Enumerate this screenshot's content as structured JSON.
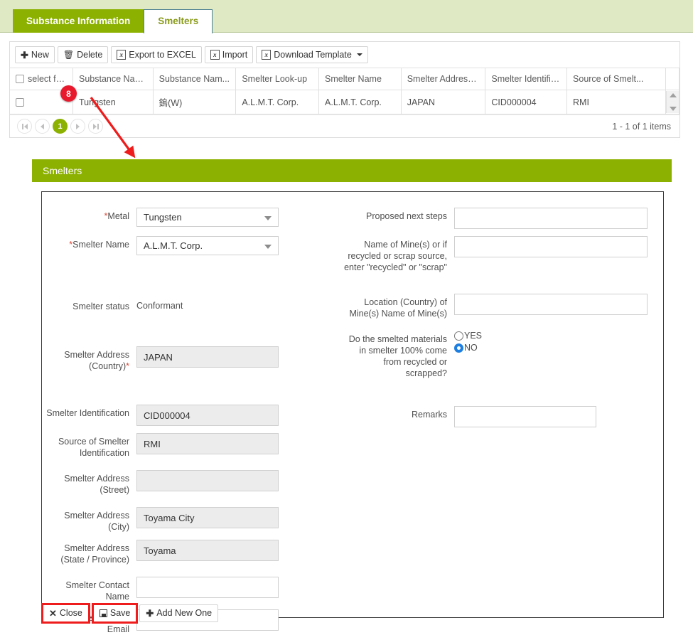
{
  "tabs": [
    {
      "label": "Substance Information",
      "state": "green"
    },
    {
      "label": "Smelters",
      "state": "selected"
    }
  ],
  "toolbar": {
    "new_label": "New",
    "delete_label": "Delete",
    "export_label": "Export to EXCEL",
    "import_label": "Import",
    "template_label": "Download Template",
    "excel_icon_text": "x"
  },
  "grid": {
    "headers": [
      "select fo...",
      "Substance Nam...",
      "Substance Nam...",
      "Smelter Look-up",
      "Smelter Name",
      "Smelter Address...",
      "Smelter Identific...",
      "Source of Smelt..."
    ],
    "rows": [
      {
        "substance_name_en": "Tungsten",
        "substance_name_local": "鎢(W)",
        "smelter_lookup": "A.L.M.T. Corp.",
        "smelter_name": "A.L.M.T. Corp.",
        "smelter_address": "JAPAN",
        "smelter_identification": "CID000004",
        "source_of_smelter": "RMI"
      }
    ],
    "pager": {
      "current_page": "1",
      "items_text": "1 - 1 of 1 items"
    }
  },
  "annotation": {
    "badge_number": "8",
    "badge_color": "#e8192c",
    "arrow_color": "#ee1c1c"
  },
  "section": {
    "title": "Smelters",
    "header_color": "#8cb100"
  },
  "form": {
    "left": [
      {
        "label": "Metal",
        "required": true,
        "type": "dropdown",
        "value": "Tungsten"
      },
      {
        "label": "Smelter Name",
        "required": true,
        "type": "dropdown",
        "value": "A.L.M.T. Corp."
      },
      {
        "label": "Smelter status",
        "required": false,
        "type": "static",
        "value": "Conformant"
      },
      {
        "label": "Smelter Address (Country)",
        "required": true,
        "type": "input",
        "value": "JAPAN",
        "filled": true
      },
      {
        "label": "Smelter Identification",
        "required": false,
        "type": "input",
        "value": "CID000004",
        "filled": true
      },
      {
        "label": "Source of Smelter Identification",
        "required": false,
        "type": "input",
        "value": "RMI",
        "filled": true
      },
      {
        "label": "Smelter Address (Street)",
        "required": false,
        "type": "input",
        "value": "",
        "filled": true
      },
      {
        "label": "Smelter Address (City)",
        "required": false,
        "type": "input",
        "value": "Toyama City",
        "filled": true
      },
      {
        "label": "Smelter Address (State / Province)",
        "required": false,
        "type": "input",
        "value": "Toyama",
        "filled": true
      },
      {
        "label": "Smelter Contact Name",
        "required": false,
        "type": "input",
        "value": "",
        "filled": false
      },
      {
        "label": "Smelter Contact Email",
        "required": false,
        "type": "input",
        "value": "",
        "filled": false
      }
    ],
    "right": [
      {
        "label": "Proposed next steps",
        "type": "input",
        "value": ""
      },
      {
        "label": "Name of Mine(s) or if recycled or scrap source, enter \"recycled\" or \"scrap\"",
        "type": "input",
        "value": ""
      },
      {
        "label": "Location (Country) of Mine(s) Name of Mine(s)",
        "type": "input",
        "value": ""
      },
      {
        "label": "Do the smelted materials in smelter 100% come from recycled or scrapped?",
        "type": "radio",
        "options": [
          "YES",
          "NO"
        ],
        "selected": "NO"
      },
      {
        "label": "Remarks",
        "type": "input",
        "value": ""
      }
    ],
    "footer": {
      "close_label": "Close",
      "save_label": "Save",
      "add_new_label": "Add New One",
      "highlight_color": "#ee1c1c"
    }
  }
}
